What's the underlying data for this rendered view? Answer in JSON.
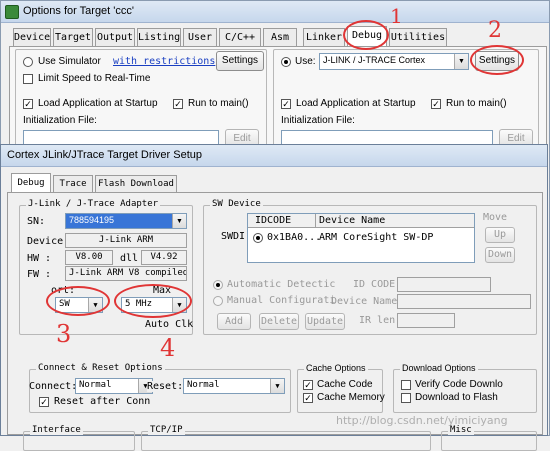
{
  "outer": {
    "title": "Options for Target 'ccc'",
    "tabs": [
      "Device",
      "Target",
      "Output",
      "Listing",
      "User",
      "C/C++",
      "Asm",
      "Linker",
      "Debug",
      "Utilities"
    ],
    "left": {
      "use_simulator": "Use Simulator",
      "with_restrictions": "with restrictions",
      "settings": "Settings",
      "limit_speed": "Limit Speed to Real-Time",
      "load_app": "Load Application at Startup",
      "run_to_main": "Run to main()",
      "init_file": "Initialization File:",
      "edit": "Edit"
    },
    "right": {
      "use": "Use:",
      "driver": "J-LINK / J-TRACE Cortex",
      "settings": "Settings",
      "load_app": "Load Application at Startup",
      "run_to_main": "Run to main()",
      "init_file": "Initialization File:",
      "edit": "Edit"
    }
  },
  "dialog": {
    "title": "Cortex JLink/JTrace Target Driver Setup",
    "tabs": [
      "Debug",
      "Trace",
      "Flash Download"
    ],
    "adapter": {
      "group": "J-Link / J-Trace Adapter",
      "sn_label": "SN:",
      "sn_value": "788594195",
      "device_label": "Device:",
      "device_value": "J-Link ARM",
      "hw_label": "HW :",
      "hw_value": "V8.00",
      "dll_label": "dll",
      "dll_value": "V4.92",
      "fw_label": "FW :",
      "fw_value": "J-Link ARM V8 compiled l",
      "port_label": "ort:",
      "port_value": "SW",
      "max_label": "Max",
      "max_value": "5 MHz",
      "auto_clk": "Auto Clk"
    },
    "sw_device": {
      "group": "SW Device",
      "swdio": "SWDI(",
      "col_idcode": "IDCODE",
      "col_device": "Device Name",
      "row_idcode": "0x1BA0...",
      "row_device": "ARM CoreSight SW-DP",
      "move": "Move",
      "up": "Up",
      "down": "Down",
      "auto_detect": "Automatic Detectic",
      "manual_config": "Manual Configurati",
      "id_code": "ID CODE:",
      "device_name": "Device Name:",
      "ir_len": "IR len:",
      "add": "Add",
      "delete": "Delete",
      "update": "Update"
    },
    "connect": {
      "group": "Connect & Reset Options",
      "connect_label": "Connect:",
      "connect_value": "Normal",
      "reset_label": "Reset:",
      "reset_value": "Normal",
      "reset_after_conn": "Reset after Conn"
    },
    "cache": {
      "group": "Cache Options",
      "cache_code": "Cache Code",
      "cache_memory": "Cache Memory"
    },
    "download": {
      "group": "Download Options",
      "verify": "Verify Code Downlo",
      "download_flash": "Download to Flash"
    },
    "bottom": {
      "interface": "Interface",
      "tcpip": "TCP/IP",
      "misc": "Misc"
    }
  },
  "annotations": {
    "n1": "1",
    "n2": "2",
    "n3": "3",
    "n4": "4",
    "watermark": "http://blog.csdn.net/yimiciyang"
  }
}
